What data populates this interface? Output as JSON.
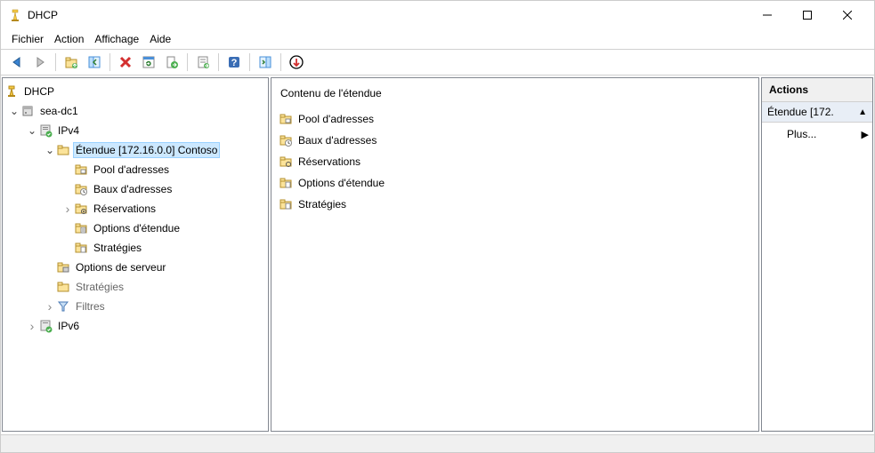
{
  "window": {
    "title": "DHCP"
  },
  "menu": {
    "items": [
      "Fichier",
      "Action",
      "Affichage",
      "Aide"
    ]
  },
  "toolbar": {
    "buttons": [
      "back",
      "forward",
      "sep",
      "up",
      "show-hide",
      "sep",
      "delete",
      "refresh",
      "export",
      "sep",
      "properties",
      "sep",
      "help",
      "sep",
      "action-pane",
      "sep",
      "new-scope"
    ]
  },
  "tree": {
    "root": {
      "label": "DHCP"
    },
    "server": {
      "label": "sea-dc1"
    },
    "ipv4": {
      "label": "IPv4"
    },
    "scope": {
      "label": "Étendue [172.16.0.0] Contoso"
    },
    "scope_children": [
      {
        "label": "Pool d'adresses",
        "icon": "folder"
      },
      {
        "label": "Baux d'adresses",
        "icon": "folder-clock"
      },
      {
        "label": "Réservations",
        "icon": "folder-gear",
        "expandable": true
      },
      {
        "label": "Options d'étendue",
        "icon": "folder-doc"
      },
      {
        "label": "Stratégies",
        "icon": "folder-doc"
      }
    ],
    "ipv4_siblings": [
      {
        "label": "Options de serveur",
        "icon": "folder-server"
      },
      {
        "label": "Stratégies",
        "icon": "folder-doc"
      },
      {
        "label": "Filtres",
        "icon": "filter",
        "expandable": true
      }
    ],
    "ipv6": {
      "label": "IPv6"
    }
  },
  "content": {
    "header": "Contenu de l'étendue",
    "items": [
      {
        "label": "Pool d'adresses",
        "icon": "folder"
      },
      {
        "label": "Baux d'adresses",
        "icon": "folder-clock"
      },
      {
        "label": "Réservations",
        "icon": "folder-gear"
      },
      {
        "label": "Options d'étendue",
        "icon": "folder-doc"
      },
      {
        "label": "Stratégies",
        "icon": "folder-doc"
      }
    ]
  },
  "actions": {
    "header": "Actions",
    "section": "Étendue [172.",
    "more": "Plus..."
  }
}
